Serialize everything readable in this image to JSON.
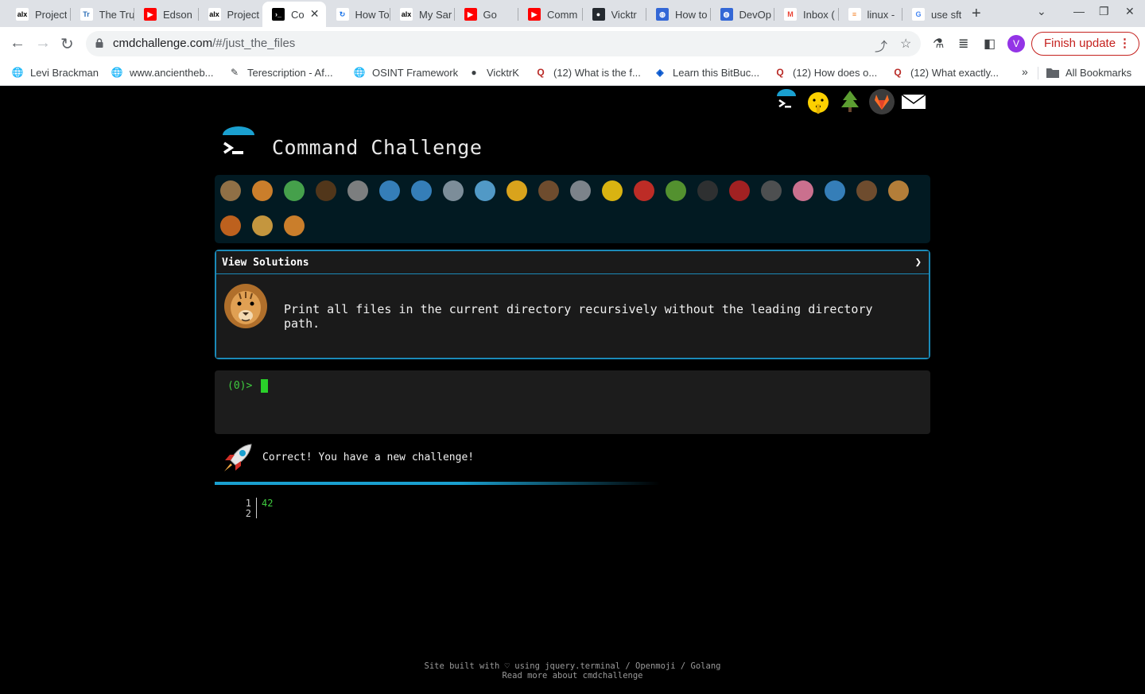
{
  "browser": {
    "tabs": [
      {
        "title": "Project",
        "favicon": "alx-icon"
      },
      {
        "title": "The Tru",
        "favicon": "tru-icon"
      },
      {
        "title": "Edson",
        "favicon": "youtube-icon"
      },
      {
        "title": "Project",
        "favicon": "alx-icon"
      },
      {
        "title": "Co",
        "favicon": "terminal-icon",
        "active": true
      },
      {
        "title": "How To",
        "favicon": "refresh-blue-icon"
      },
      {
        "title": "My Sar",
        "favicon": "alx-icon"
      },
      {
        "title": "Go",
        "favicon": "youtube-icon"
      },
      {
        "title": "Comm",
        "favicon": "youtube-icon"
      },
      {
        "title": "Vicktr",
        "favicon": "github-icon"
      },
      {
        "title": "How to",
        "favicon": "globe-icon"
      },
      {
        "title": "DevOp",
        "favicon": "globe-icon"
      },
      {
        "title": "Inbox (",
        "favicon": "gmail-icon"
      },
      {
        "title": "linux -",
        "favicon": "stackoverflow-icon"
      },
      {
        "title": "use sft",
        "favicon": "google-icon"
      }
    ],
    "url_host": "cmdchallenge.com",
    "url_path": "/#/just_the_files",
    "profile_initial": "V",
    "update_label": "Finish update",
    "bookmarks": [
      {
        "label": "Levi Brackman",
        "icon": "globe-icon"
      },
      {
        "label": "www.ancientheb...",
        "icon": "globe-icon"
      },
      {
        "label": "Terescription - Af...",
        "icon": "pen-icon"
      },
      {
        "label": "OSINT Framework",
        "icon": "globe-icon"
      },
      {
        "label": "VicktrK",
        "icon": "github-icon"
      },
      {
        "label": "(12) What is the f...",
        "icon": "quora-icon"
      },
      {
        "label": "Learn this BitBuc...",
        "icon": "bitbucket-icon"
      },
      {
        "label": "(12) How does o...",
        "icon": "quora-icon"
      },
      {
        "label": "(12) What exactly...",
        "icon": "quora-icon"
      }
    ],
    "all_bookmarks_label": "All Bookmarks"
  },
  "page": {
    "title": "Command Challenge",
    "top_icons": [
      "terminal-icon",
      "shushing-face-icon",
      "tree-icon",
      "gitlab-icon",
      "envelope-icon"
    ],
    "animals": [
      "snail",
      "butterfly",
      "caterpillar",
      "ant",
      "spider-web",
      "whale",
      "dolphin-blue",
      "dolphin",
      "fish",
      "tropical-fish",
      "otter",
      "wolf",
      "bee",
      "ladybug",
      "cucumber",
      "spider",
      "scorpion",
      "fly",
      "worm",
      "bacteria",
      "monkey",
      "dog",
      "fox",
      "cat",
      "tiger"
    ],
    "solutions_label": "View Solutions",
    "challenge_text": "Print all files in the current directory recursively without the leading directory path.",
    "prompt": "(0)>",
    "result_text": "Correct! You have a new challenge!",
    "progress": 0.55,
    "output_lines": [
      {
        "num": "1",
        "value": "42"
      },
      {
        "num": "2",
        "value": ""
      }
    ],
    "footer_line1": "Site built with ♡ using jquery.terminal / Openmoji / Golang",
    "footer_line2": "Read more about cmdchallenge"
  },
  "colors": {
    "accent": "#1b8ab8",
    "prompt_green": "#3fcc3f",
    "update_red": "#c5221f"
  }
}
